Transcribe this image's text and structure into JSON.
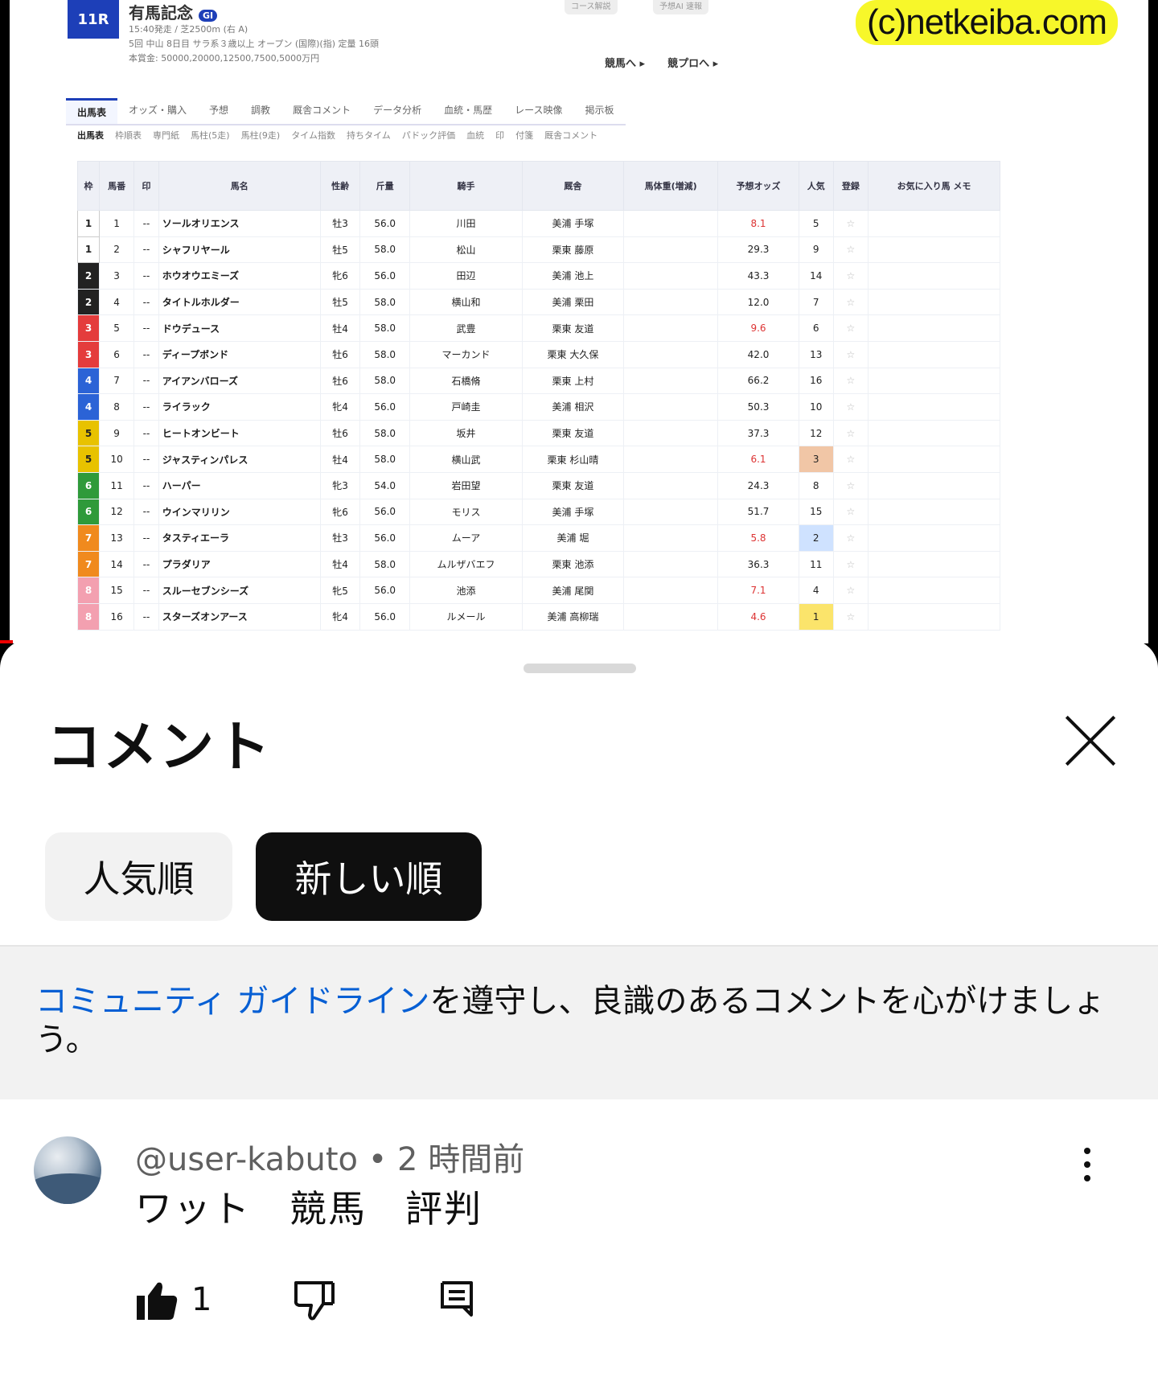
{
  "video": {
    "race_badge": "11R",
    "race_title": "有馬記念",
    "race_grade": "GI",
    "race_info_line1": "15:40発走 / 芝2500m (右 A)",
    "race_info_line2": "5回 中山 8日目 サラ系３歳以上 オープン (国際)(指) 定量 16頭",
    "race_info_line3": "本賞金: 50000,20000,12500,7500,5000万円",
    "links": [
      "競馬へ ▸",
      "競プロへ ▸"
    ],
    "top_pills": [
      "コース解説",
      "予想AI 速報"
    ],
    "watermark": "(c)netkeiba.com",
    "tabs": [
      "出馬表",
      "オッズ・購入",
      "予想",
      "調教",
      "厩舎コメント",
      "データ分析",
      "血統・馬歴",
      "レース映像",
      "掲示板"
    ],
    "subtabs": [
      "出馬表",
      "枠順表",
      "専門紙",
      "馬柱(5走)",
      "馬柱(9走)",
      "タイム指数",
      "持ちタイム",
      "パドック評価",
      "血統",
      "印",
      "付箋",
      "厩舎コメント"
    ],
    "table_headers": [
      "枠",
      "馬番",
      "印",
      "馬名",
      "性齢",
      "斤量",
      "騎手",
      "厩舎",
      "馬体重(増減)",
      "予想オッズ",
      "人気",
      "登録",
      "お気に入り馬 メモ"
    ],
    "rows": [
      {
        "waku": "1",
        "num": "1",
        "mark": "--",
        "name": "ソールオリエンス",
        "sex": "牡3",
        "kin": "56.0",
        "jockey": "川田",
        "stable": "美浦 手塚",
        "odds": "8.1",
        "pop": "5"
      },
      {
        "waku": "1",
        "num": "2",
        "mark": "--",
        "name": "シャフリヤール",
        "sex": "牡5",
        "kin": "58.0",
        "jockey": "松山",
        "stable": "栗東 藤原",
        "odds": "29.3",
        "pop": "9"
      },
      {
        "waku": "2",
        "num": "3",
        "mark": "--",
        "name": "ホウオウエミーズ",
        "sex": "牝6",
        "kin": "56.0",
        "jockey": "田辺",
        "stable": "美浦 池上",
        "odds": "43.3",
        "pop": "14"
      },
      {
        "waku": "2",
        "num": "4",
        "mark": "--",
        "name": "タイトルホルダー",
        "sex": "牡5",
        "kin": "58.0",
        "jockey": "横山和",
        "stable": "美浦 栗田",
        "odds": "12.0",
        "pop": "7"
      },
      {
        "waku": "3",
        "num": "5",
        "mark": "--",
        "name": "ドウデュース",
        "sex": "牡4",
        "kin": "58.0",
        "jockey": "武豊",
        "stable": "栗東 友道",
        "odds": "9.6",
        "pop": "6"
      },
      {
        "waku": "3",
        "num": "6",
        "mark": "--",
        "name": "ディープボンド",
        "sex": "牡6",
        "kin": "58.0",
        "jockey": "マーカンド",
        "stable": "栗東 大久保",
        "odds": "42.0",
        "pop": "13"
      },
      {
        "waku": "4",
        "num": "7",
        "mark": "--",
        "name": "アイアンバローズ",
        "sex": "牡6",
        "kin": "58.0",
        "jockey": "石橋脩",
        "stable": "栗東 上村",
        "odds": "66.2",
        "pop": "16"
      },
      {
        "waku": "4",
        "num": "8",
        "mark": "--",
        "name": "ライラック",
        "sex": "牝4",
        "kin": "56.0",
        "jockey": "戸崎圭",
        "stable": "美浦 相沢",
        "odds": "50.3",
        "pop": "10"
      },
      {
        "waku": "5",
        "num": "9",
        "mark": "--",
        "name": "ヒートオンビート",
        "sex": "牡6",
        "kin": "58.0",
        "jockey": "坂井",
        "stable": "栗東 友道",
        "odds": "37.3",
        "pop": "12"
      },
      {
        "waku": "5",
        "num": "10",
        "mark": "--",
        "name": "ジャスティンパレス",
        "sex": "牡4",
        "kin": "58.0",
        "jockey": "横山武",
        "stable": "栗東 杉山晴",
        "odds": "6.1",
        "pop": "3"
      },
      {
        "waku": "6",
        "num": "11",
        "mark": "--",
        "name": "ハーパー",
        "sex": "牝3",
        "kin": "54.0",
        "jockey": "岩田望",
        "stable": "栗東 友道",
        "odds": "24.3",
        "pop": "8"
      },
      {
        "waku": "6",
        "num": "12",
        "mark": "--",
        "name": "ウインマリリン",
        "sex": "牝6",
        "kin": "56.0",
        "jockey": "モリス",
        "stable": "美浦 手塚",
        "odds": "51.7",
        "pop": "15"
      },
      {
        "waku": "7",
        "num": "13",
        "mark": "--",
        "name": "タスティエーラ",
        "sex": "牡3",
        "kin": "56.0",
        "jockey": "ムーア",
        "stable": "美浦 堀",
        "odds": "5.8",
        "pop": "2"
      },
      {
        "waku": "7",
        "num": "14",
        "mark": "--",
        "name": "プラダリア",
        "sex": "牡4",
        "kin": "58.0",
        "jockey": "ムルザバエフ",
        "stable": "栗東 池添",
        "odds": "36.3",
        "pop": "11"
      },
      {
        "waku": "8",
        "num": "15",
        "mark": "--",
        "name": "スルーセブンシーズ",
        "sex": "牝5",
        "kin": "56.0",
        "jockey": "池添",
        "stable": "美浦 尾関",
        "odds": "7.1",
        "pop": "4"
      },
      {
        "waku": "8",
        "num": "16",
        "mark": "--",
        "name": "スターズオンアース",
        "sex": "牝4",
        "kin": "56.0",
        "jockey": "ルメール",
        "stable": "美浦 高柳瑞",
        "odds": "4.6",
        "pop": "1"
      }
    ]
  },
  "sheet": {
    "title": "コメント",
    "chips": {
      "popular": "人気順",
      "newest": "新しい順"
    },
    "guideline_link": "コミュニティ ガイドライン",
    "guideline_text": "を遵守し、良識のあるコメントを心がけましょう。"
  },
  "comment": {
    "author": "@user-kabuto",
    "separator": " • ",
    "time": "2 時間前",
    "text": "ワット　競馬　評判",
    "likes": "1"
  },
  "colors": {
    "waku": {
      "1": "#ffffff",
      "2": "#222222",
      "3": "#e43c3c",
      "4": "#2b63d6",
      "5": "#e8c200",
      "6": "#2f9a3a",
      "7": "#f08a1e",
      "8": "#f3a0b0"
    },
    "link": "#065fd4",
    "chip_selected": "#0f0f0f"
  }
}
